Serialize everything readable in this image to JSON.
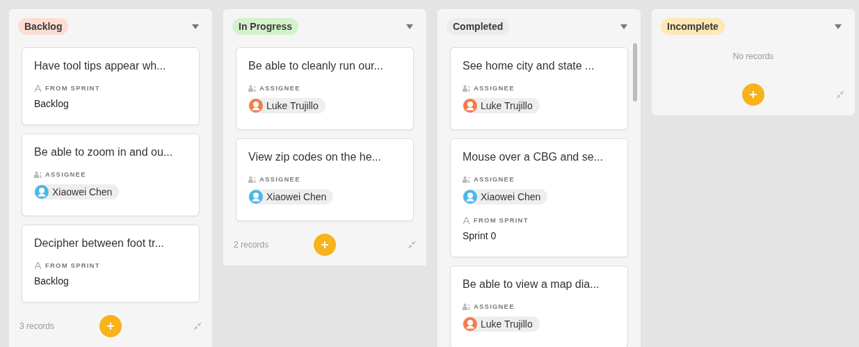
{
  "columns": [
    {
      "title": "Backlog",
      "color": "#fcdcd3",
      "cards": [
        {
          "title": "Have tool tips appear wh...",
          "fields": [
            {
              "kind": "sprint",
              "label": "FROM SPRINT",
              "value": "Backlog"
            }
          ]
        },
        {
          "title": "Be able to zoom in and ou...",
          "fields": [
            {
              "kind": "assignee",
              "label": "ASSIGNEE",
              "value": "Xiaowei Chen",
              "color": "#4bb7e8"
            }
          ]
        },
        {
          "title": "Decipher between foot tr...",
          "fields": [
            {
              "kind": "sprint",
              "label": "FROM SPRINT",
              "value": "Backlog"
            }
          ]
        }
      ],
      "count": "3 records"
    },
    {
      "title": "In Progress",
      "color": "#d3f1ca",
      "cards": [
        {
          "title": "Be able to cleanly run our...",
          "fields": [
            {
              "kind": "assignee",
              "label": "ASSIGNEE",
              "value": "Luke Trujillo",
              "color": "#f47c4a"
            }
          ]
        },
        {
          "title": "View zip codes on the he...",
          "fields": [
            {
              "kind": "assignee",
              "label": "ASSIGNEE",
              "value": "Xiaowei Chen",
              "color": "#4bb7e8"
            }
          ]
        }
      ],
      "count": "2 records"
    },
    {
      "title": "Completed",
      "color": "#ececec",
      "cards": [
        {
          "title": "See home city and state ...",
          "fields": [
            {
              "kind": "assignee",
              "label": "ASSIGNEE",
              "value": "Luke Trujillo",
              "color": "#f47c4a"
            }
          ]
        },
        {
          "title": "Mouse over a CBG and se...",
          "fields": [
            {
              "kind": "assignee",
              "label": "ASSIGNEE",
              "value": "Xiaowei Chen",
              "color": "#4bb7e8"
            },
            {
              "kind": "sprint",
              "label": "FROM SPRINT",
              "value": "Sprint 0"
            }
          ]
        },
        {
          "title": "Be able to view a map dia...",
          "fields": [
            {
              "kind": "assignee",
              "label": "ASSIGNEE",
              "value": "Luke Trujillo",
              "color": "#f47c4a"
            }
          ]
        }
      ]
    },
    {
      "title": "Incomplete",
      "color": "#fde8b6",
      "empty": "No records"
    }
  ]
}
